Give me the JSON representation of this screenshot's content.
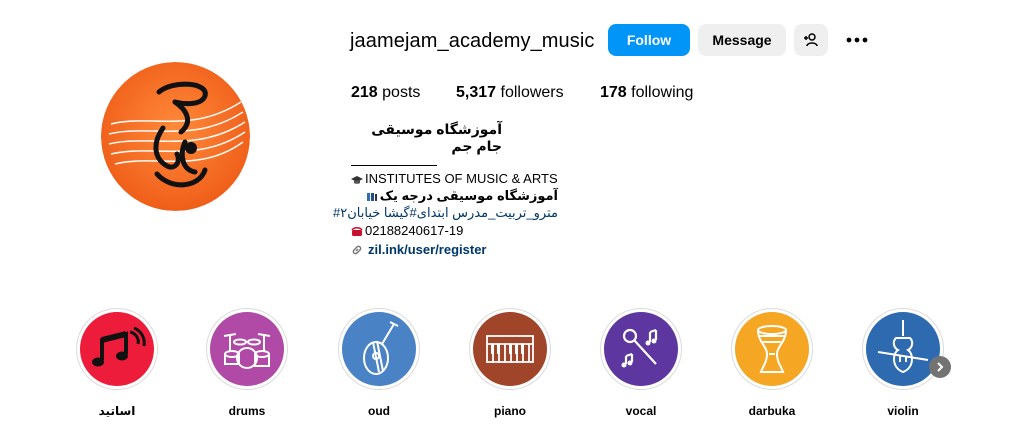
{
  "profile": {
    "username": "jaamejam_academy_music",
    "follow_label": "Follow",
    "message_label": "Message",
    "posts_count": "218",
    "posts_label": "posts",
    "followers_count": "5,317",
    "followers_label": "followers",
    "following_count": "178",
    "following_label": "following",
    "full_name": "آموزشگاه موسیقی جام جم",
    "bio_lines": [
      "INSTITUTES OF MUSIC & ARTS",
      "آموزشگاه موسیقی درجه یک",
      "مترو_تربیت_مدرس ابتدای#گیشا خیابان۲#",
      "02188240617-19"
    ],
    "link_text": "zil.ink/user/register"
  },
  "highlights": [
    {
      "label": "اساتید",
      "icon": "music-notes-icon",
      "color": "#ed1c3a"
    },
    {
      "label": "drums",
      "icon": "drum-kit-icon",
      "color": "#b04aa6"
    },
    {
      "label": "oud",
      "icon": "oud-icon",
      "color": "#4a83c5"
    },
    {
      "label": "piano",
      "icon": "keyboard-icon",
      "color": "#a0442a"
    },
    {
      "label": "vocal",
      "icon": "microphone-icon",
      "color": "#5d36a0"
    },
    {
      "label": "darbuka",
      "icon": "darbuka-icon",
      "color": "#f5a623"
    },
    {
      "label": "violin",
      "icon": "violin-icon",
      "color": "#2e6ab0"
    }
  ],
  "colors": {
    "follow": "#0095f6",
    "secondary_button": "#efefef",
    "link": "#00376b",
    "avatar_orange": "#f26a22"
  }
}
